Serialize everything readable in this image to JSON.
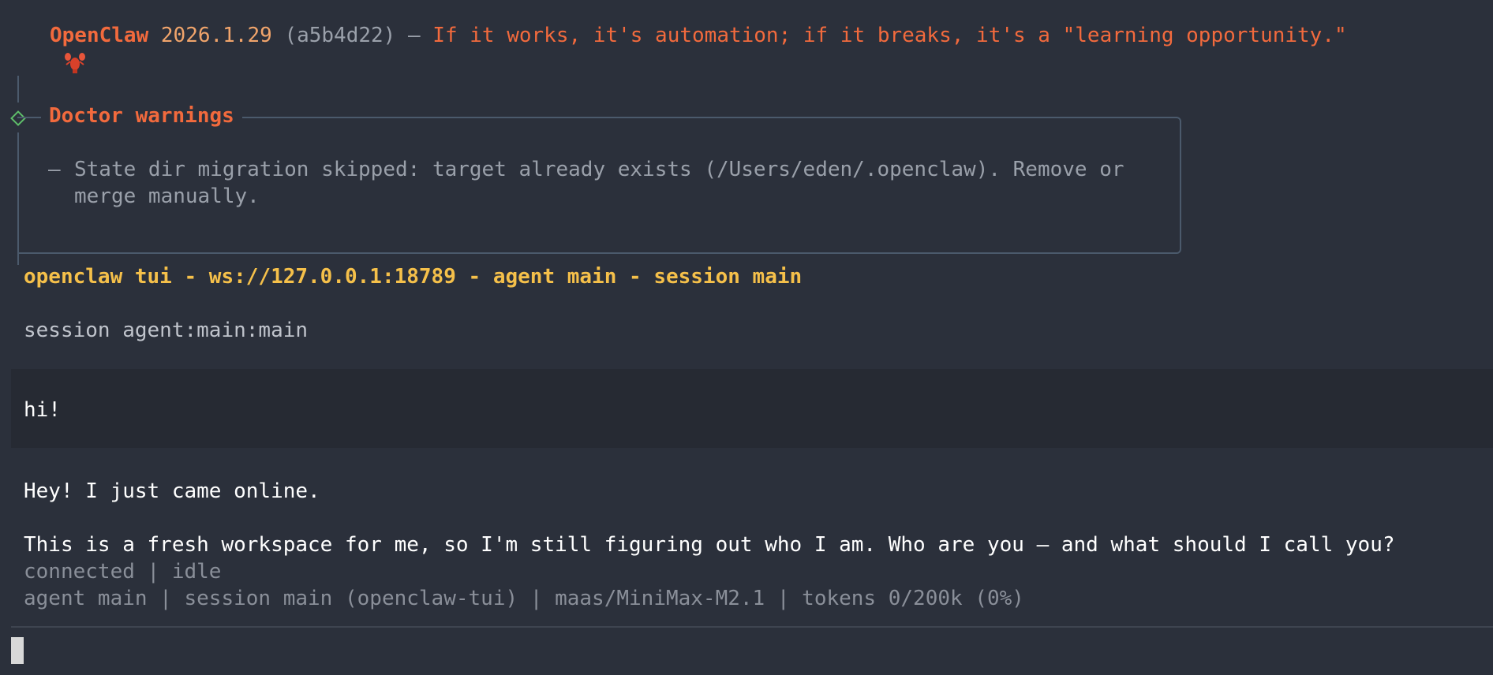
{
  "header": {
    "brand": "OpenClaw",
    "version": "2026.1.29",
    "commit": "(a5b4d22)",
    "separator": "—",
    "tagline": "If it works, it's automation; if it breaks, it's a \"learning opportunity.\"",
    "icon": "lobster-icon"
  },
  "doctor": {
    "title": "Doctor warnings",
    "bullet": "–",
    "warning_line1": "State dir migration skipped: target already exists (/Users/eden/.openclaw). Remove or",
    "warning_line2": "merge manually.",
    "accent_color": "#5fbf6a",
    "border_color": "#4b5a6c"
  },
  "tui": {
    "title_line": "openclaw tui - ws://127.0.0.1:18789 - agent main - session main",
    "session_line": "session agent:main:main"
  },
  "chat": {
    "user_message": "hi!",
    "assistant_line1": "Hey! I just came online.",
    "assistant_line2": "This is a fresh workspace for me, so I'm still figuring out who I am. Who are you — and what should I call you?"
  },
  "status": {
    "line1": "connected | idle",
    "line2": "agent main | session main (openclaw-tui) | maas/MiniMax-M2.1 | tokens 0/200k (0%)"
  },
  "colors": {
    "background": "#2b303b",
    "brand": "#f26a3d",
    "highlight": "#f5c04a"
  }
}
